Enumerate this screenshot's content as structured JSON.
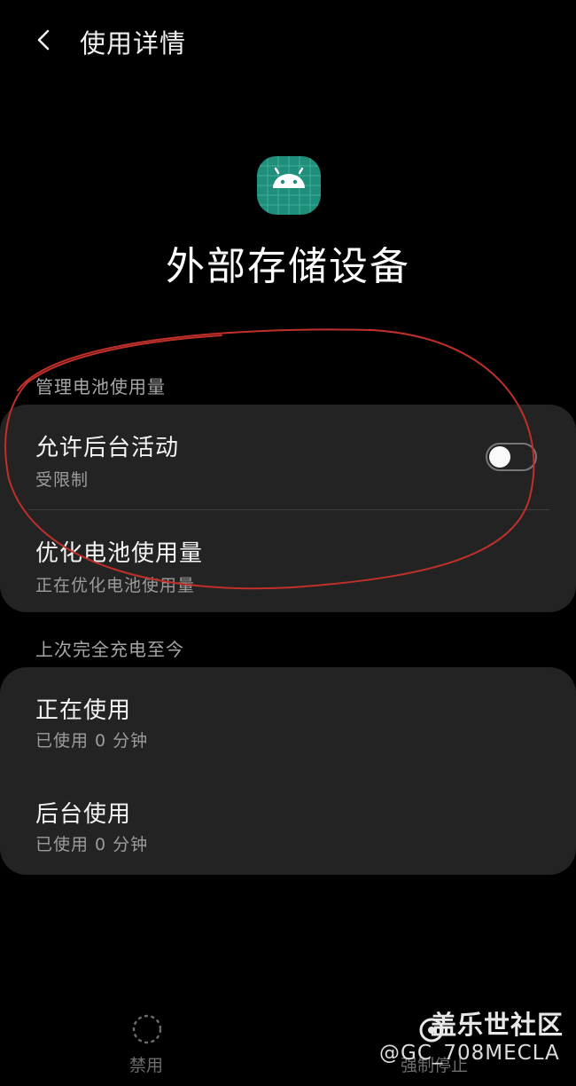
{
  "header": {
    "title": "使用详情",
    "back_icon": "chevron-left-icon"
  },
  "app": {
    "name": "外部存储设备",
    "icon": "android-icon",
    "icon_color": "#1f8f7c"
  },
  "battery_section": {
    "label": "管理电池使用量",
    "rows": [
      {
        "title": "允许后台活动",
        "subtitle": "受限制",
        "toggle_on": false
      },
      {
        "title": "优化电池使用量",
        "subtitle": "正在优化电池使用量"
      }
    ]
  },
  "usage_section": {
    "label": "上次完全充电至今",
    "rows": [
      {
        "title": "正在使用",
        "subtitle": "已使用 0 分钟"
      },
      {
        "title": "后台使用",
        "subtitle": "已使用 0 分钟"
      }
    ]
  },
  "bottom_bar": {
    "disable_label": "禁用",
    "disable_icon": "dashed-circle-icon",
    "force_stop_label": "强制停止"
  },
  "watermark": {
    "brand": "盖乐世社区",
    "handle": "@GC_708MECLA"
  },
  "annotation_color": "#c0302a"
}
